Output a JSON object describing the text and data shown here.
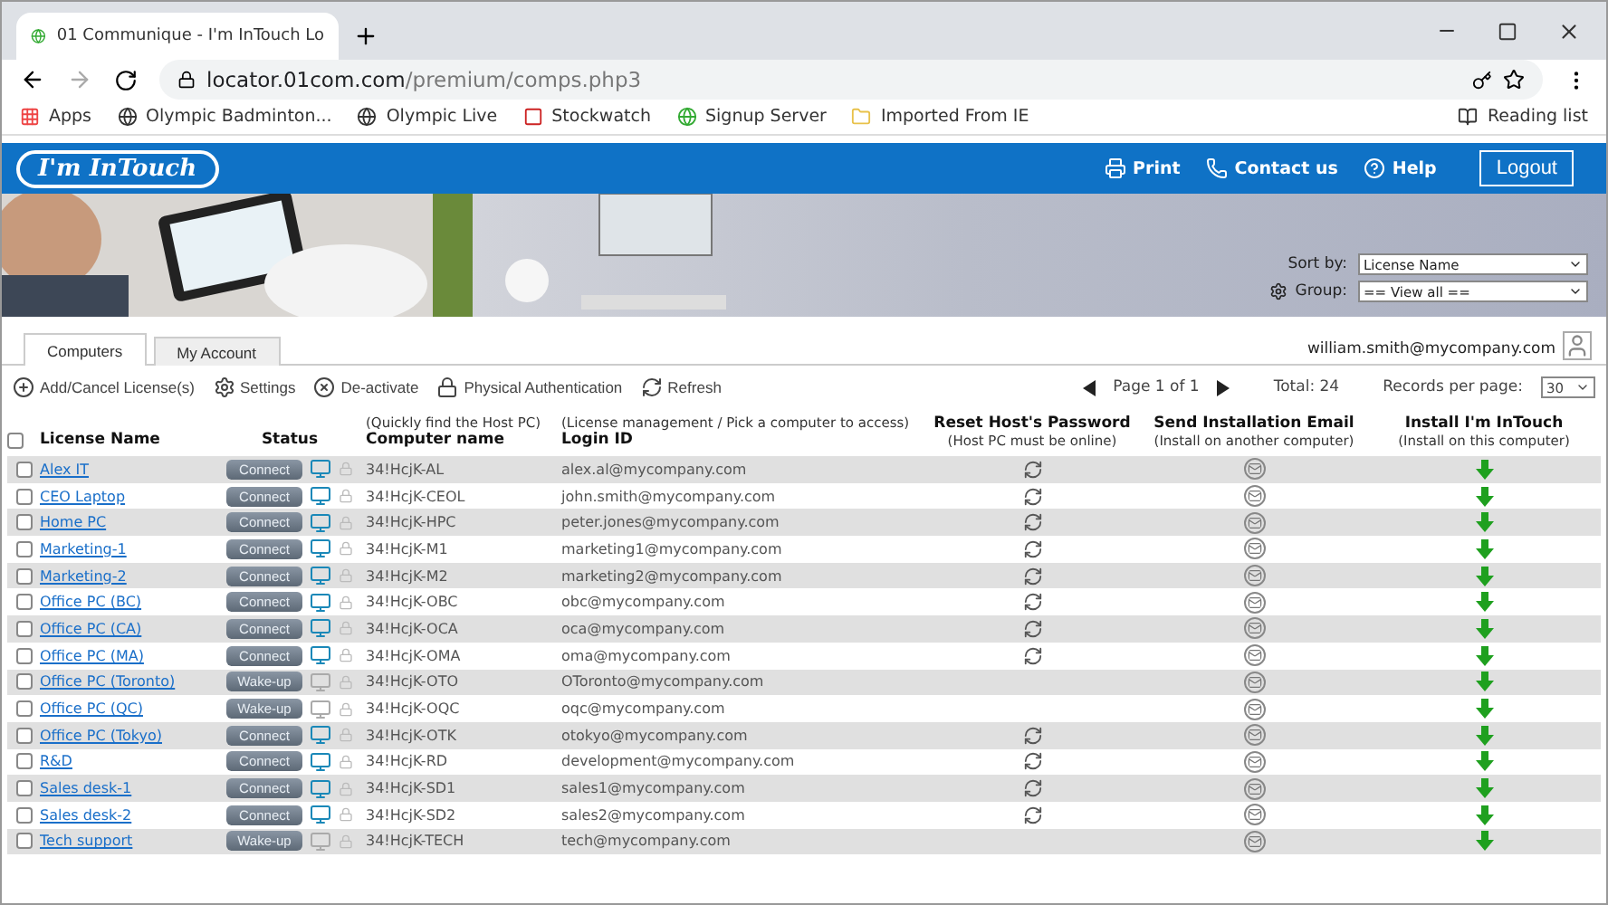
{
  "browser": {
    "tab_title": "01 Communique - I'm InTouch Lo",
    "url_host": "locator.01com.com",
    "url_path": "/premium/comps.php3",
    "bookmarks": [
      "Apps",
      "Olympic Badminton...",
      "Olympic Live",
      "Stockwatch",
      "Signup Server",
      "Imported From IE"
    ],
    "reading_list": "Reading list"
  },
  "header": {
    "logo": "I'm InTouch",
    "links": [
      "Print",
      "Contact us",
      "Help"
    ],
    "logout": "Logout"
  },
  "filters": {
    "sort_label": "Sort by:",
    "sort_value": "License Name",
    "group_label": "Group:",
    "group_value": "== View all =="
  },
  "tabs": [
    {
      "label": "Computers",
      "selected": true
    },
    {
      "label": "My Account",
      "selected": false
    }
  ],
  "user": "william.smith@mycompany.com",
  "select_all_checked": false,
  "toolbar": [
    "Add/Cancel License(s)",
    "Settings",
    "De-activate",
    "Physical Authentication",
    "Refresh"
  ],
  "pager": {
    "page": "Page 1 of 1",
    "total": "Total: 24",
    "per_page_label": "Records per page:",
    "per_page": "30"
  },
  "columns": {
    "name": "License Name",
    "status": "Status",
    "computer_hint": "(Quickly find the Host PC)",
    "computer": "Computer name",
    "login_hint": "(License management / Pick a computer to access)",
    "login": "Login ID",
    "reset": "Reset Host's Password",
    "reset_hint": "(Host PC must be online)",
    "email": "Send Installation Email",
    "email_hint": "(Install on another computer)",
    "install": "Install I'm InTouch",
    "install_hint": "(Install on this computer)"
  },
  "rows": [
    {
      "name": "Alex IT",
      "action": "Connect",
      "online": true,
      "checked": false,
      "computer": "34!HcjK-AL",
      "login": "alex.al@mycompany.com"
    },
    {
      "name": "CEO Laptop",
      "action": "Connect",
      "online": true,
      "checked": false,
      "computer": "34!HcjK-CEOL",
      "login": "john.smith@mycompany.com"
    },
    {
      "name": "Home PC",
      "action": "Connect",
      "online": true,
      "checked": false,
      "computer": "34!HcjK-HPC",
      "login": "peter.jones@mycompany.com"
    },
    {
      "name": "Marketing-1",
      "action": "Connect",
      "online": true,
      "checked": false,
      "computer": "34!HcjK-M1",
      "login": "marketing1@mycompany.com"
    },
    {
      "name": "Marketing-2",
      "action": "Connect",
      "online": true,
      "checked": false,
      "computer": "34!HcjK-M2",
      "login": "marketing2@mycompany.com"
    },
    {
      "name": "Office PC (BC)",
      "action": "Connect",
      "online": true,
      "checked": false,
      "computer": "34!HcjK-OBC",
      "login": "obc@mycompany.com"
    },
    {
      "name": "Office PC (CA)",
      "action": "Connect",
      "online": true,
      "checked": false,
      "computer": "34!HcjK-OCA",
      "login": "oca@mycompany.com"
    },
    {
      "name": "Office PC (MA)",
      "action": "Connect",
      "online": true,
      "checked": false,
      "computer": "34!HcjK-OMA",
      "login": "oma@mycompany.com"
    },
    {
      "name": "Office PC (Toronto)",
      "action": "Wake-up",
      "online": false,
      "checked": false,
      "computer": "34!HcjK-OTO",
      "login": "OToronto@mycompany.com"
    },
    {
      "name": "Office PC (QC)",
      "action": "Wake-up",
      "online": false,
      "checked": false,
      "computer": "34!HcjK-OQC",
      "login": "oqc@mycompany.com"
    },
    {
      "name": "Office PC (Tokyo)",
      "action": "Connect",
      "online": true,
      "checked": false,
      "computer": "34!HcjK-OTK",
      "login": "otokyo@mycompany.com"
    },
    {
      "name": "R&D",
      "action": "Connect",
      "online": true,
      "checked": false,
      "computer": "34!HcjK-RD",
      "login": "development@mycompany.com"
    },
    {
      "name": "Sales desk-1",
      "action": "Connect",
      "online": true,
      "checked": false,
      "computer": "34!HcjK-SD1",
      "login": "sales1@mycompany.com"
    },
    {
      "name": "Sales desk-2",
      "action": "Connect",
      "online": true,
      "checked": false,
      "computer": "34!HcjK-SD2",
      "login": "sales2@mycompany.com"
    },
    {
      "name": "Tech support",
      "action": "Wake-up",
      "online": false,
      "checked": false,
      "computer": "34!HcjK-TECH",
      "login": "tech@mycompany.com"
    }
  ]
}
